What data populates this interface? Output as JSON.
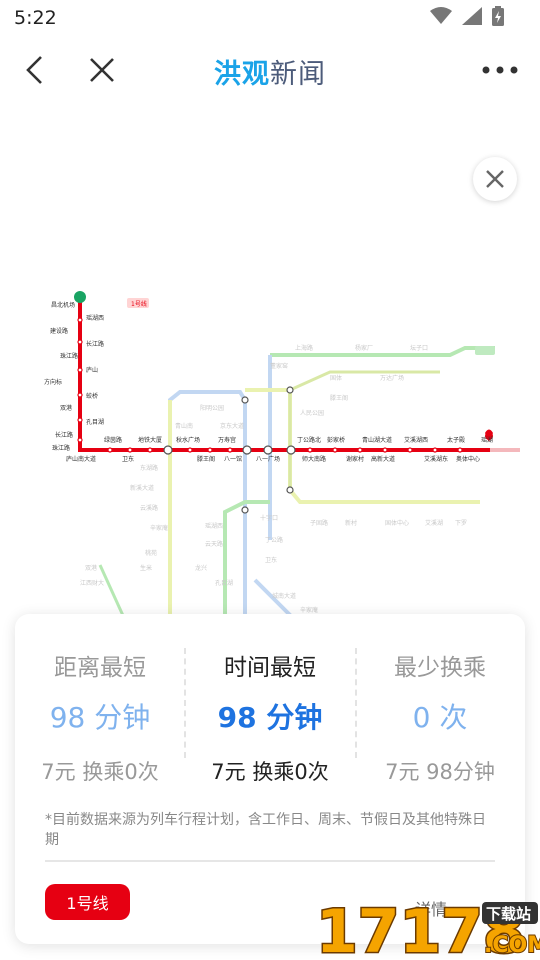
{
  "status": {
    "time": "5:22"
  },
  "header": {
    "logo_a": "洪观",
    "logo_b": "新闻"
  },
  "map": {
    "line1": {
      "stations_top": [
        "昌北机场",
        "瑶湖西",
        "长江路",
        "城市之光",
        "秋水广场",
        "万寿宫",
        "八一广场",
        "丁公路北",
        "彭家桥",
        "青山湖大道",
        "艾溪湖西",
        "太子殿",
        "奥体中心"
      ],
      "stations_bottom": [
        "庐山南大道",
        "卫东",
        "绿茵路",
        "地铁大厦",
        "滕王阁",
        "八一馆",
        "孔目湖",
        "下罗",
        "高新大道",
        "艾溪湖东",
        "国体中心"
      ],
      "branch": [
        "双港",
        "孔目湖",
        "长江路",
        "珠江路",
        "庐山",
        "蛟桥",
        "南昌西站"
      ]
    }
  },
  "options": [
    {
      "title": "距离最短",
      "value": "98 分钟",
      "sub": "7元  换乘0次"
    },
    {
      "title": "时间最短",
      "value": "98 分钟",
      "sub": "7元  换乘0次"
    },
    {
      "title": "最少换乘",
      "value": "0 次",
      "sub": "7元  98分钟"
    }
  ],
  "note": "*目前数据来源为列车行程计划，含工作日、周末、节假日及其他特殊日期",
  "line_badge": "1号线",
  "details_label": "详情",
  "watermark": {
    "brand": "17178",
    "sub": "下载站",
    "domain": ".COM"
  }
}
